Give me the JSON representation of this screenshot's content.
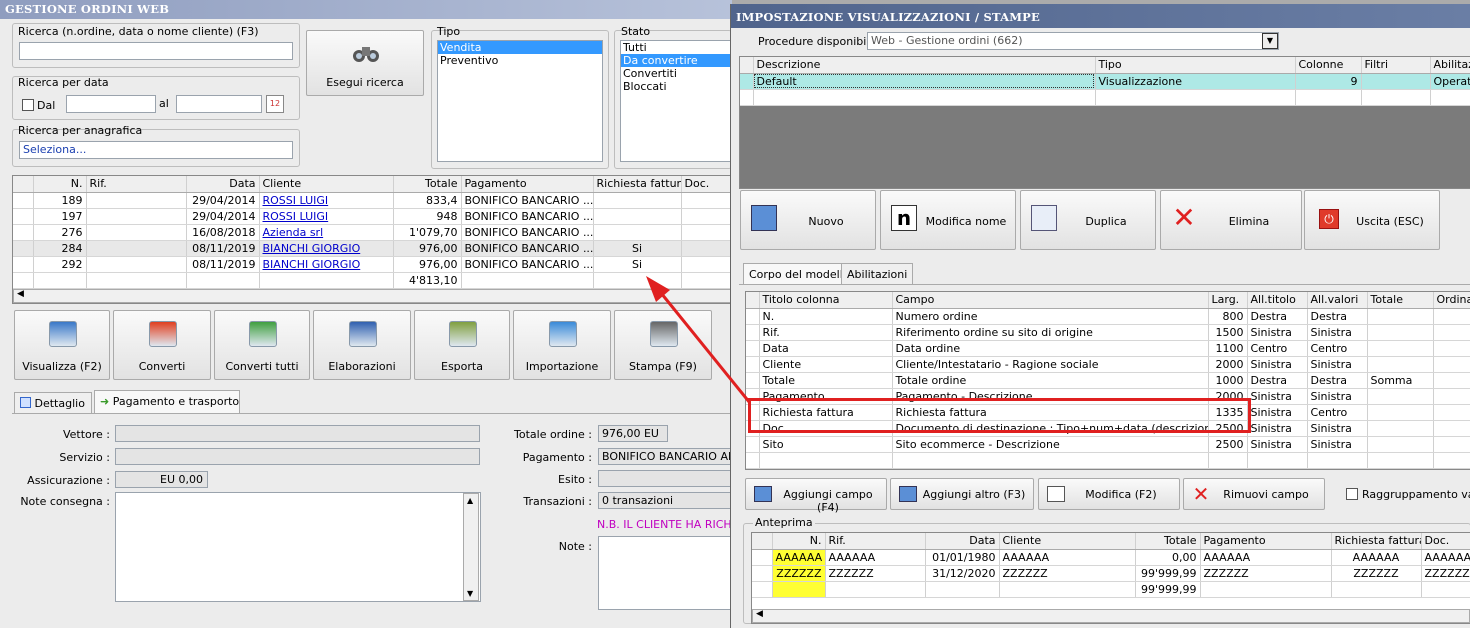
{
  "left": {
    "title": "GESTIONE ORDINI WEB",
    "search_label": "Ricerca (n.ordine, data o nome cliente) (F3)",
    "search_value": "",
    "date_label": "Ricerca per data",
    "dal_label": "Dal",
    "al_label": "al",
    "anag_label": "Ricerca per anagrafica",
    "anag_value": "Seleziona...",
    "exec_button": "Esegui ricerca",
    "tipo_label": "Tipo",
    "tipo_items": [
      "Vendita",
      "Preventivo"
    ],
    "stato_label": "Stato",
    "stato_items": [
      "Tutti",
      "Da convertire",
      "Convertiti",
      "Bloccati"
    ],
    "table_headers": [
      "N.",
      "Rif.",
      "Data",
      "Cliente",
      "Totale",
      "Pagamento",
      "Richiesta fattura",
      "Doc."
    ],
    "rows": [
      [
        "189",
        "",
        "29/04/2014",
        "ROSSI LUIGI",
        "833,4",
        "BONIFICO BANCARIO ...",
        "",
        ""
      ],
      [
        "197",
        "",
        "29/04/2014",
        "ROSSI LUIGI",
        "948",
        "BONIFICO BANCARIO ...",
        "",
        ""
      ],
      [
        "276",
        "",
        "16/08/2018",
        "Azienda srl",
        "1'079,70",
        "BONIFICO BANCARIO ...",
        "",
        ""
      ],
      [
        "284",
        "",
        "08/11/2019",
        "BIANCHI GIORGIO",
        "976,00",
        "BONIFICO BANCARIO ...",
        "Si",
        ""
      ],
      [
        "292",
        "",
        "08/11/2019",
        "BIANCHI GIORGIO",
        "976,00",
        "BONIFICO BANCARIO ...",
        "Si",
        ""
      ]
    ],
    "total": "4'813,10",
    "toolbar": [
      "Visualizza (F2)",
      "Converti",
      "Converti tutti",
      "Elaborazioni",
      "Esporta",
      "Importazione",
      "Stampa (F9)"
    ],
    "tabs": [
      "Dettaglio",
      "Pagamento e trasporto"
    ],
    "vettore_label": "Vettore :",
    "servizio_label": "Servizio :",
    "assic_label": "Assicurazione :",
    "assic_value": "EU 0,00",
    "note_consegna_label": "Note consegna :",
    "totale_label": "Totale ordine :",
    "totale_value": "976,00 EU",
    "pagamento_label": "Pagamento :",
    "pagamento_value": "BONIFICO BANCARIO ANTI",
    "esito_label": "Esito :",
    "transazioni_label": "Transazioni :",
    "transazioni_value": "0 transazioni",
    "nb_text": "N.B. IL CLIENTE HA RICHIE",
    "note_label": "Note :"
  },
  "right": {
    "title": "IMPOSTAZIONE VISUALIZZAZIONI / STAMPE",
    "proc_label": "Procedure disponibili :",
    "proc_value": "Web - Gestione ordini (662)",
    "top_headers": [
      "Descrizione",
      "Tipo",
      "Colonne",
      "Filtri",
      "Abilitazi"
    ],
    "top_row": [
      "Default",
      "Visualizzazione",
      "9",
      "",
      "Operato"
    ],
    "buttons": [
      "Nuovo",
      "Modifica nome",
      "Duplica",
      "Elimina",
      "Uscita (ESC)"
    ],
    "tabs": [
      "Corpo del modello",
      "Abilitazioni"
    ],
    "col_headers": [
      "Titolo colonna",
      "Campo",
      "Larg.",
      "All.titolo",
      "All.valori",
      "Totale",
      "Ordinar"
    ],
    "col_rows": [
      [
        "N.",
        "Numero ordine",
        "800",
        "Destra",
        "Destra",
        ""
      ],
      [
        "Rif.",
        "Riferimento ordine su sito di origine",
        "1500",
        "Sinistra",
        "Sinistra",
        ""
      ],
      [
        "Data",
        "Data ordine",
        "1100",
        "Centro",
        "Centro",
        ""
      ],
      [
        "Cliente",
        "Cliente/Intestatario - Ragione sociale",
        "2000",
        "Sinistra",
        "Sinistra",
        ""
      ],
      [
        "Totale",
        "Totale ordine",
        "1000",
        "Destra",
        "Destra",
        "Somma"
      ],
      [
        "Pagamento",
        "Pagamento - Descrizione",
        "2000",
        "Sinistra",
        "Sinistra",
        ""
      ],
      [
        "Richiesta fattura",
        "Richiesta fattura",
        "1335",
        "Sinistra",
        "Centro",
        ""
      ],
      [
        "Doc.",
        "Documento di destinazione : Tipo+num+data (descrizione bre...",
        "2500",
        "Sinistra",
        "Sinistra",
        ""
      ],
      [
        "Sito",
        "Sito ecommerce - Descrizione",
        "2500",
        "Sinistra",
        "Sinistra",
        ""
      ]
    ],
    "action_buttons": [
      "Aggiungi campo (F4)",
      "Aggiungi altro (F3)",
      "Modifica (F2)",
      "Rimuovi campo"
    ],
    "raggr_label": "Raggruppamento valor",
    "anteprima_label": "Anteprima",
    "prev_headers": [
      "N.",
      "Rif.",
      "Data",
      "Cliente",
      "Totale",
      "Pagamento",
      "Richiesta fattura",
      "Doc."
    ],
    "prev_rows": [
      [
        "AAAAAA",
        "AAAAAA",
        "01/01/1980",
        "AAAAAA",
        "0,00",
        "AAAAAA",
        "AAAAAA",
        "AAAAAA"
      ],
      [
        "ZZZZZZ",
        "ZZZZZZ",
        "31/12/2020",
        "ZZZZZZ",
        "99'999,99",
        "ZZZZZZ",
        "ZZZZZZ",
        "ZZZZZZ"
      ]
    ],
    "prev_total": "99'999,99"
  },
  "colors": {
    "titlebar_left": "#9aa8c6",
    "titlebar_right": "#596c92",
    "highlight_red": "#e02020",
    "selection": "#3399ff",
    "cyan_row": "#aee9e6",
    "yellow": "#ffff33"
  }
}
